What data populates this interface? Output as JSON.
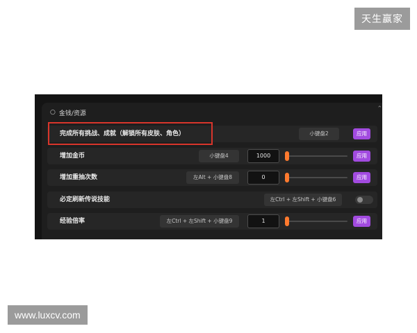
{
  "watermarks": {
    "top_right": "天生赢家",
    "bottom_left": "www.luxcv.com"
  },
  "section": {
    "icon": "mouse-icon",
    "title": "金钱/资源"
  },
  "rows": [
    {
      "label": "完成所有挑战、成就（解锁所有皮肤、角色）",
      "hotkey": "小键盘2",
      "apply": "应用"
    },
    {
      "label": "增加金币",
      "hotkey": "小键盘4",
      "value": "1000",
      "slider_level": 0,
      "apply": "应用"
    },
    {
      "label": "增加重抽次数",
      "hotkey": "左Alt + 小键盘8",
      "value": "0",
      "slider_level": 0,
      "apply": "应用"
    },
    {
      "label": "必定刷新传说技能",
      "hotkey": "左Ctrl + 左Shift + 小键盘6",
      "toggle_on": false
    },
    {
      "label": "经验倍率",
      "hotkey": "左Ctrl + 左Shift + 小键盘9",
      "value": "1",
      "slider_level": 0,
      "apply": "应用"
    }
  ],
  "colors": {
    "apply_button": "#a24be0",
    "slider_thumb": "#ff7a2e",
    "highlight_box": "#d9352b"
  }
}
